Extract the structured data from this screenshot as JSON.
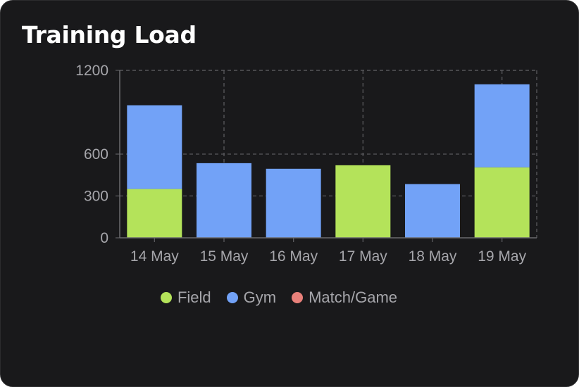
{
  "card": {
    "title": "Training Load"
  },
  "colors": {
    "background": "#19191b",
    "field": "#b4e35a",
    "gym": "#72a2f7",
    "match": "#e8807a",
    "grid": "#5a5a5e",
    "text": "#a6a6ab"
  },
  "legend": [
    {
      "label": "Field",
      "color": "#b4e35a"
    },
    {
      "label": "Gym",
      "color": "#72a2f7"
    },
    {
      "label": "Match/Game",
      "color": "#e8807a"
    }
  ],
  "chart_data": {
    "type": "bar",
    "stacked": true,
    "title": "Training Load",
    "categories": [
      "14 May",
      "15 May",
      "16 May",
      "17 May",
      "18 May",
      "19 May"
    ],
    "series": [
      {
        "name": "Field",
        "color": "#b4e35a",
        "values": [
          350,
          0,
          0,
          520,
          0,
          505
        ]
      },
      {
        "name": "Gym",
        "color": "#72a2f7",
        "values": [
          600,
          535,
          495,
          0,
          385,
          595
        ]
      },
      {
        "name": "Match/Game",
        "color": "#e8807a",
        "values": [
          0,
          0,
          0,
          0,
          0,
          0
        ]
      }
    ],
    "yticks": [
      0,
      300,
      600,
      1200
    ],
    "ylim": [
      0,
      1200
    ],
    "grid": true,
    "legend_position": "bottom"
  }
}
